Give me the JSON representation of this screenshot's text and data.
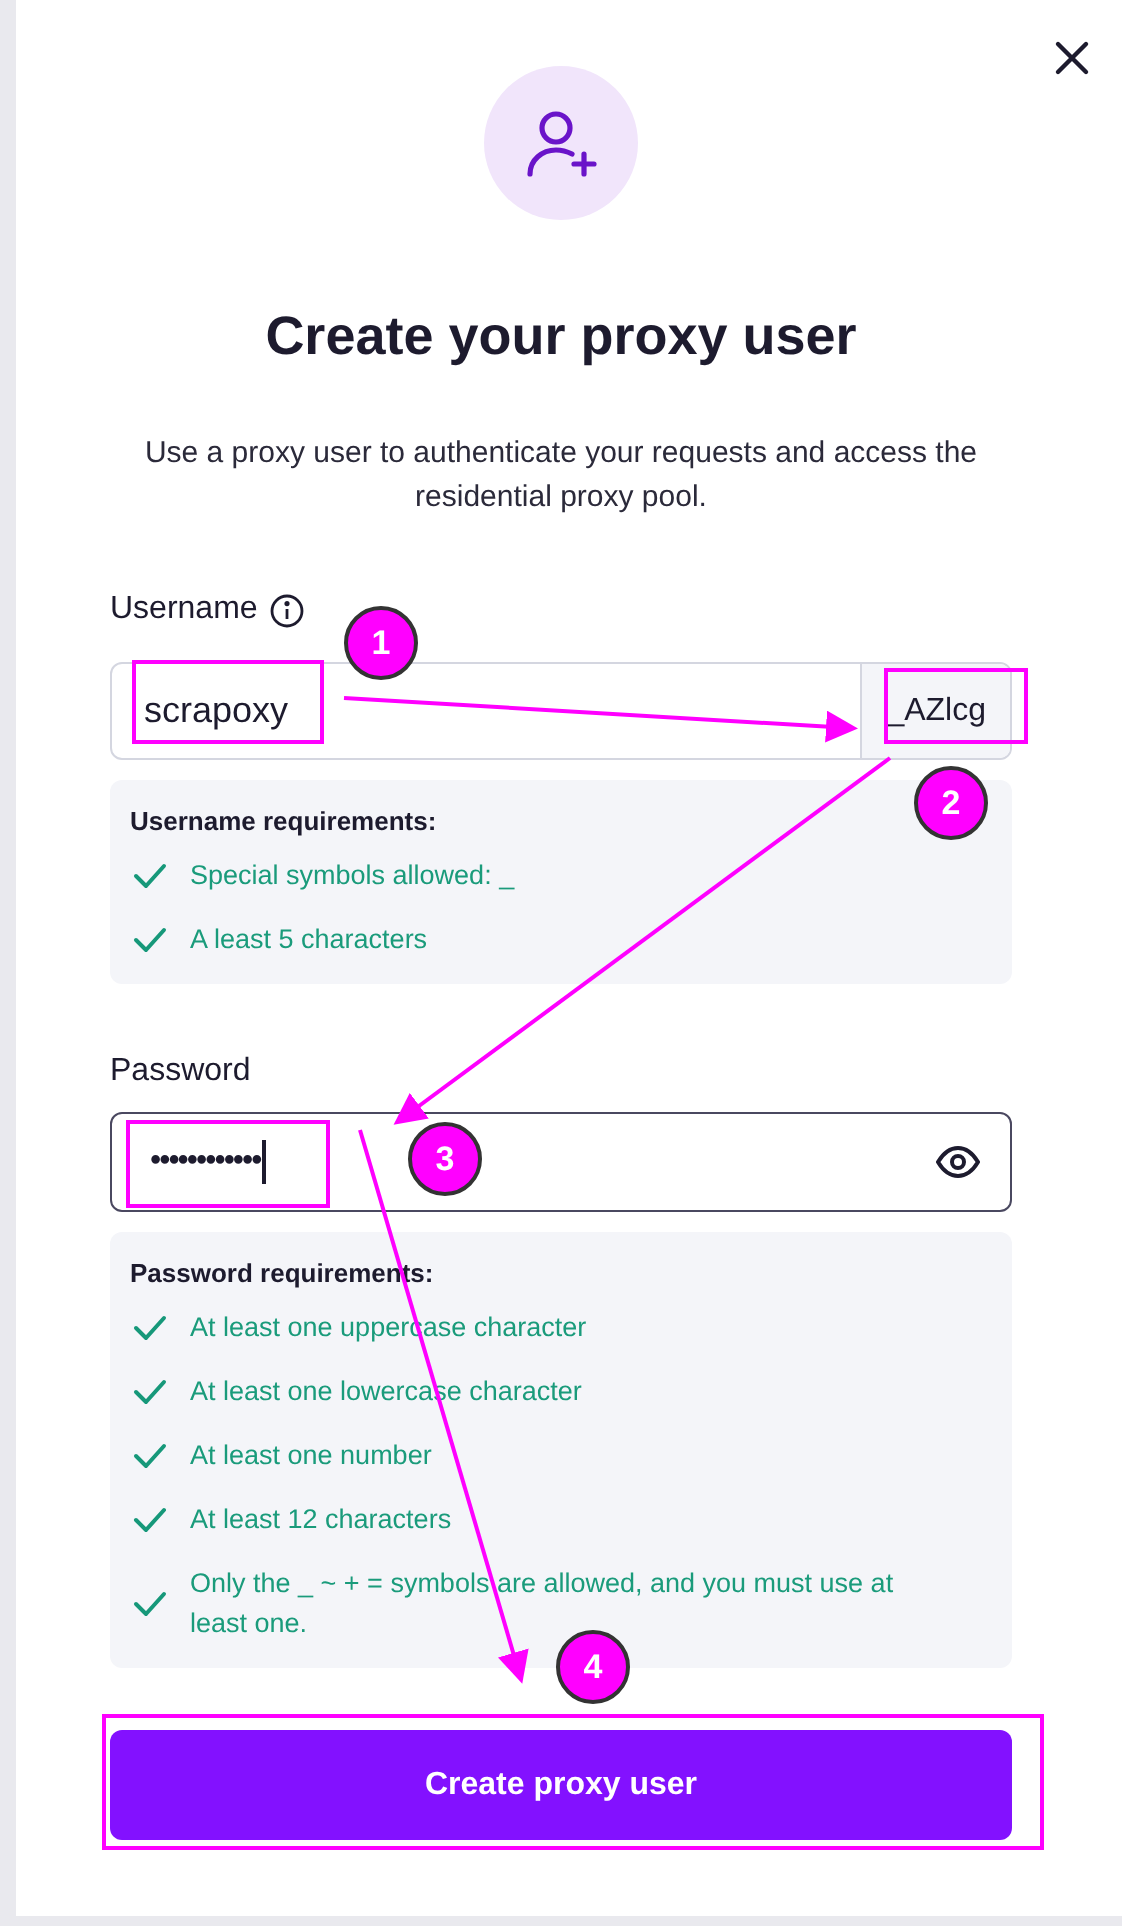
{
  "dialog": {
    "title": "Create your proxy user",
    "description": "Use a proxy user to authenticate your requests and access the residential proxy pool."
  },
  "username": {
    "label": "Username",
    "value": "scrapoxy",
    "suffix": "_AZlcg",
    "requirements_title": "Username requirements:",
    "requirements": [
      {
        "text": "Special symbols allowed: _",
        "met": true
      },
      {
        "text": "A least 5 characters",
        "met": true
      }
    ]
  },
  "password": {
    "label": "Password",
    "value": "••••••••••••",
    "requirements_title": "Password requirements:",
    "requirements": [
      {
        "text": "At least one uppercase character",
        "met": true
      },
      {
        "text": "At least one lowercase character",
        "met": true
      },
      {
        "text": "At least one number",
        "met": true
      },
      {
        "text": "At least 12 characters",
        "met": true
      },
      {
        "text": "Only the _ ~ + = symbols are allowed, and you must use at least one.",
        "met": true
      }
    ]
  },
  "submit": {
    "label": "Create proxy user"
  },
  "annotations": {
    "callouts": [
      "1",
      "2",
      "3",
      "4"
    ]
  }
}
